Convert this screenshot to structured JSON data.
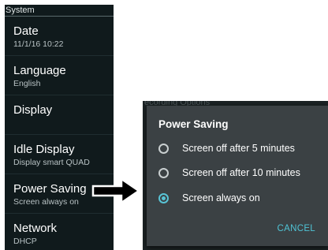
{
  "settings": {
    "header": "System",
    "items": [
      {
        "title": "Date",
        "subtitle": "11/1/16 10:22"
      },
      {
        "title": "Language",
        "subtitle": "English"
      },
      {
        "title": "Display",
        "subtitle": ""
      },
      {
        "title": "Idle Display",
        "subtitle": "Display smart QUAD"
      },
      {
        "title": "Power Saving",
        "subtitle": "Screen always on"
      },
      {
        "title": "Network",
        "subtitle": "DHCP"
      }
    ]
  },
  "arrow_icon": "right-arrow-icon",
  "background_fragment": {
    "top_text": "ecording Options"
  },
  "dialog": {
    "title": "Power Saving",
    "options": [
      {
        "label": "Screen off after 5 minutes",
        "checked": false
      },
      {
        "label": "Screen off after 10 minutes",
        "checked": false
      },
      {
        "label": "Screen always on",
        "checked": true
      }
    ],
    "cancel_label": "CANCEL"
  },
  "colors": {
    "accent": "#58c4d6",
    "settings_bg": "#101a1c",
    "dialog_bg": "#3b4144"
  }
}
